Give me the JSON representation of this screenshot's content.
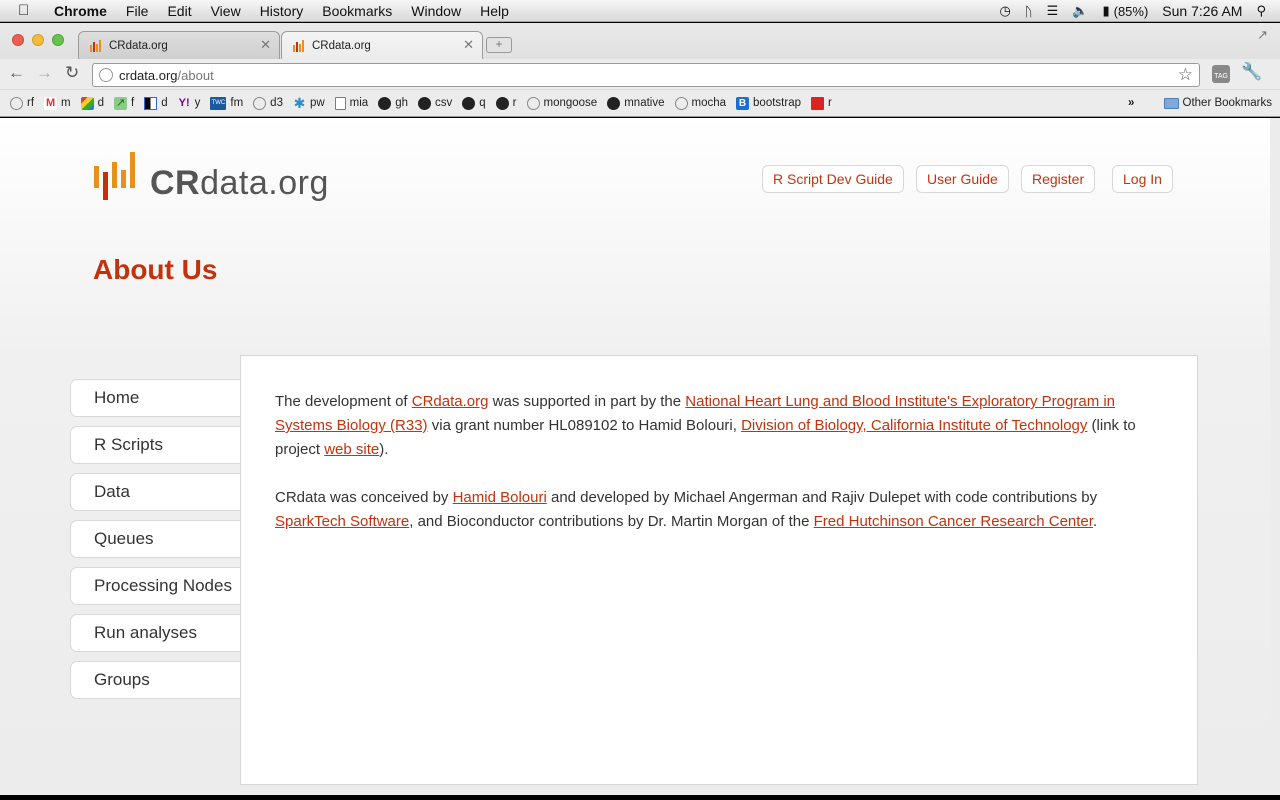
{
  "menubar": {
    "app": "Chrome",
    "items": [
      "File",
      "Edit",
      "View",
      "History",
      "Bookmarks",
      "Window",
      "Help"
    ],
    "battery": "(85%)",
    "clock": "Sun 7:26 AM"
  },
  "tabs": [
    {
      "title": "CRdata.org",
      "active": false
    },
    {
      "title": "CRdata.org",
      "active": true
    }
  ],
  "omnibox": {
    "host": "crdata.org",
    "path": "/about"
  },
  "bookmarks": [
    {
      "label": "rf",
      "icon": "globe-icon"
    },
    {
      "label": "m",
      "icon": "gmail-icon"
    },
    {
      "label": "d",
      "icon": "google-icon"
    },
    {
      "label": "f",
      "icon": "chart-icon"
    },
    {
      "label": "d",
      "icon": "delicious-icon"
    },
    {
      "label": "y",
      "icon": "yahoo-icon"
    },
    {
      "label": "fm",
      "icon": "twc-icon"
    },
    {
      "label": "d3",
      "icon": "globe-icon"
    },
    {
      "label": "pw",
      "icon": "puzzle-icon"
    },
    {
      "label": "mia",
      "icon": "page-icon"
    },
    {
      "label": "gh",
      "icon": "github-icon"
    },
    {
      "label": "csv",
      "icon": "github-icon"
    },
    {
      "label": "q",
      "icon": "github-icon"
    },
    {
      "label": "r",
      "icon": "github-icon"
    },
    {
      "label": "mongoose",
      "icon": "globe-icon"
    },
    {
      "label": "mnative",
      "icon": "github-icon"
    },
    {
      "label": "mocha",
      "icon": "globe-icon"
    },
    {
      "label": "bootstrap",
      "icon": "bootstrap-icon"
    },
    {
      "label": "r",
      "icon": "ruby-icon"
    }
  ],
  "other_bookmarks": "Other Bookmarks",
  "site": {
    "logo_bold": "CR",
    "logo_rest": "data.org",
    "nav": [
      "R Script Dev Guide",
      "User Guide",
      "Register",
      "Log In"
    ],
    "title": "About Us",
    "sidebar": [
      "Home",
      "R Scripts",
      "Data",
      "Queues",
      "Processing Nodes",
      "Run analyses",
      "Groups"
    ],
    "p1": {
      "t1": "The development of ",
      "l1": "CRdata.org",
      "t2": " was supported in part by the ",
      "l2": "National Heart Lung and Blood Institute's Exploratory Program in Systems Biology (R33)",
      "t3": " via grant number HL089102 to Hamid Bolouri, ",
      "l3": "Division of Biology, California Institute of Technology",
      "t4": " (link to project ",
      "l4": "web site",
      "t5": ")."
    },
    "p2": {
      "t1": "CRdata was conceived by ",
      "l1": "Hamid Bolouri",
      "t2": " and developed by Michael Angerman and Rajiv Dulepet with code contributions by ",
      "l2": "SparkTech Software",
      "t3": ", and Bioconductor contributions by Dr. Martin Morgan of the ",
      "l3": "Fred Hutchinson Cancer Research Center",
      "t4": "."
    }
  },
  "colors": {
    "accent": "#c4320d",
    "logo_orange": "#e8901a",
    "logo_red": "#c4320d"
  }
}
